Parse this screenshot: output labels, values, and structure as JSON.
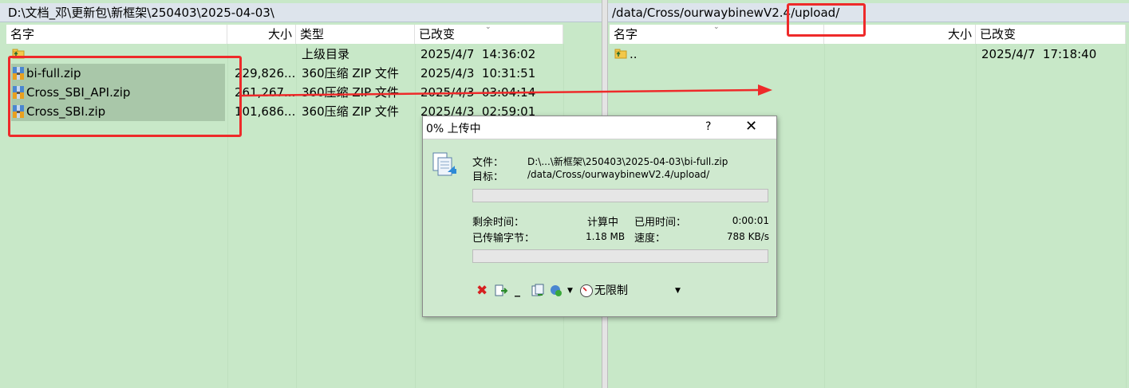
{
  "left_pane": {
    "path": "D:\\文档_邓\\更新包\\新框架\\250403\\2025-04-03\\",
    "columns": {
      "name": "名字",
      "size": "大小",
      "type": "类型",
      "modified": "已改变"
    },
    "rows": [
      {
        "name": "",
        "size": "",
        "type": "上级目录",
        "modified": "2025/4/7  14:36:02"
      },
      {
        "name": "bi-full.zip",
        "size": "229,826...",
        "type": "360压缩 ZIP 文件",
        "modified": "2025/4/3  10:31:51"
      },
      {
        "name": "Cross_SBI_API.zip",
        "size": "261,267...",
        "type": "360压缩 ZIP 文件",
        "modified": "2025/4/3  03:04:14"
      },
      {
        "name": "Cross_SBI.zip",
        "size": "101,686...",
        "type": "360压缩 ZIP 文件",
        "modified": "2025/4/3  02:59:01"
      }
    ]
  },
  "right_pane": {
    "path": "/data/Cross/ourwaybinewV2.4/upload/",
    "columns": {
      "name": "名字",
      "size": "大小",
      "modified": "已改变"
    },
    "rows": [
      {
        "name": "..",
        "size": "",
        "modified": "2025/4/7  17:18:40"
      }
    ]
  },
  "dialog": {
    "title": "0% 上传中",
    "help": "?",
    "close": "✕",
    "file_label": "文件：",
    "file_value": "D:\\...\\新框架\\250403\\2025-04-03\\bi-full.zip",
    "target_label": "目标：",
    "target_value": "/data/Cross/ourwaybinewV2.4/upload/",
    "progress_file": 0,
    "remaining_label": "剩余时间：",
    "remaining_value": "计算中",
    "elapsed_label": "已用时间：",
    "elapsed_value": "0:00:01",
    "transferred_label": "已传输字节：",
    "transferred_value": "1.18 MB",
    "speed_label": "速度：",
    "speed_value": "788 KB/s",
    "progress_total": 0,
    "speed_limit": "无限制"
  },
  "colors": {
    "pane_bg": "#c8e8c8",
    "selection": "#a9c7a9",
    "annotation_red": "#ee2a2a"
  }
}
